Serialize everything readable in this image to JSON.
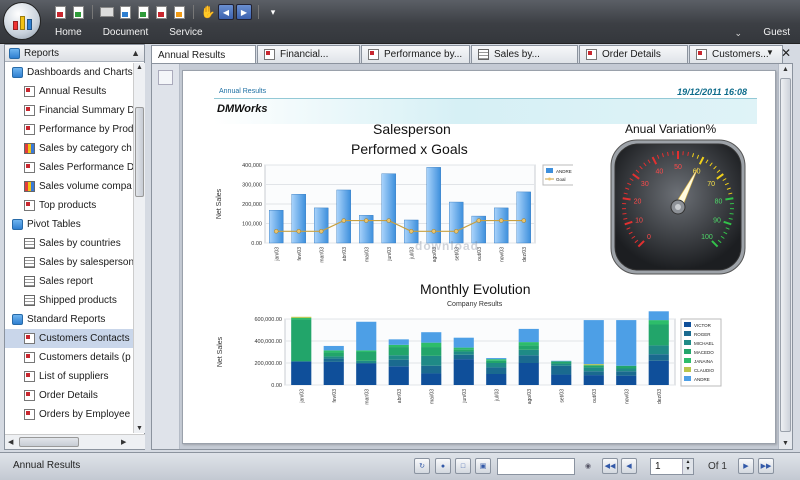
{
  "app": {
    "menu": [
      "Home",
      "Document",
      "Service"
    ],
    "user": "Guest"
  },
  "sidebar": {
    "title": "Reports",
    "groups": [
      {
        "label": "Dashboards and Charts",
        "items": [
          {
            "label": "Annual Results",
            "icon": "report-icon"
          },
          {
            "label": "Financial Summary D",
            "icon": "report-icon"
          },
          {
            "label": "Performance by Prod",
            "icon": "report-icon"
          },
          {
            "label": "Sales by category ch",
            "icon": "chart-icon"
          },
          {
            "label": "Sales Performance D",
            "icon": "report-icon"
          },
          {
            "label": "Sales volume compa",
            "icon": "chart-icon"
          },
          {
            "label": "Top products",
            "icon": "report-icon"
          }
        ]
      },
      {
        "label": "Pivot Tables",
        "items": [
          {
            "label": "Sales by countries",
            "icon": "grid-icon"
          },
          {
            "label": "Sales by salesperson",
            "icon": "grid-icon"
          },
          {
            "label": "Sales report",
            "icon": "grid-icon"
          },
          {
            "label": "Shipped products",
            "icon": "grid-icon"
          }
        ]
      },
      {
        "label": "Standard Reports",
        "items": [
          {
            "label": "Customers Contacts",
            "icon": "report-icon",
            "selected": true
          },
          {
            "label": "Customers details (p",
            "icon": "report-icon"
          },
          {
            "label": "List of suppliers",
            "icon": "report-icon"
          },
          {
            "label": "Order Details",
            "icon": "report-icon"
          },
          {
            "label": "Orders by Employee",
            "icon": "report-icon"
          }
        ]
      }
    ]
  },
  "tabs": [
    {
      "label": "Annual Results",
      "icon": "",
      "active": true
    },
    {
      "label": "Financial...",
      "icon": "report-icon"
    },
    {
      "label": "Performance by...",
      "icon": "report-icon"
    },
    {
      "label": "Sales by...",
      "icon": "grid-icon"
    },
    {
      "label": "Order Details",
      "icon": "report-icon"
    },
    {
      "label": "Customers...",
      "icon": "report-icon"
    }
  ],
  "report": {
    "name": "Annual Results",
    "date": "19/12/2011 16:08",
    "company": "DMWorks",
    "watermark": "download"
  },
  "chart_data": [
    {
      "type": "bar",
      "title": "Salesperson Performed x Goals",
      "title_lines": [
        "Salesperson",
        "Performed x Goals"
      ],
      "ylabel": "Net Sales",
      "ylim": [
        0,
        400000
      ],
      "yticks": [
        "0.00",
        "100,000",
        "200,000",
        "300,000",
        "400,000"
      ],
      "categories": [
        "jan/03",
        "fev/03",
        "mar/03",
        "abr/03",
        "mai/03",
        "jun/03",
        "jul/03",
        "ago/03",
        "set/03",
        "out/03",
        "nov/03",
        "dez/03"
      ],
      "series": [
        {
          "name": "ANDRE",
          "kind": "bar",
          "color": "#3d8fdc",
          "values": [
            168000,
            250000,
            180000,
            272000,
            142000,
            355000,
            118000,
            388000,
            210000,
            138000,
            180000,
            262000
          ]
        },
        {
          "name": "Goal",
          "kind": "line",
          "color": "#c8a040",
          "values": [
            60000,
            60000,
            60000,
            115000,
            115000,
            115000,
            60000,
            60000,
            60000,
            115000,
            115000,
            115000
          ]
        }
      ],
      "legend": "top-right"
    },
    {
      "type": "gauge",
      "title": "Anual Variation%",
      "min": 0,
      "max": 100,
      "ticks": [
        "0",
        "10",
        "20",
        "30",
        "40",
        "50",
        "60",
        "70",
        "80",
        "90",
        "100"
      ],
      "value": 60
    },
    {
      "type": "bar",
      "stacked": true,
      "title": "Monthly Evolution",
      "subtitle": "Company Results",
      "ylabel": "Net Sales",
      "ylim": [
        0,
        600000
      ],
      "yticks": [
        "0.00",
        "200,000.00",
        "400,000.00",
        "600,000.00"
      ],
      "categories": [
        "jan/03",
        "fev/03",
        "mar/03",
        "abr/03",
        "mai/03",
        "jun/03",
        "jul/03",
        "ago/03",
        "set/03",
        "out/03",
        "nov/03",
        "dez/03"
      ],
      "series": [
        {
          "name": "VICTOR",
          "color": "#0f4f9a",
          "values": [
            215000,
            210000,
            195000,
            170000,
            105000,
            235000,
            100000,
            200000,
            95000,
            90000,
            85000,
            220000
          ]
        },
        {
          "name": "ROGER",
          "color": "#1a6a8f",
          "values": [
            0,
            30000,
            5000,
            60000,
            70000,
            40000,
            60000,
            70000,
            80000,
            35000,
            40000,
            60000
          ]
        },
        {
          "name": "MICHAEL",
          "color": "#1f8a86",
          "values": [
            0,
            20000,
            20000,
            40000,
            90000,
            30000,
            40000,
            50000,
            20000,
            35000,
            25000,
            80000
          ]
        },
        {
          "name": "MACEDO",
          "color": "#22a56a",
          "values": [
            380000,
            35000,
            80000,
            75000,
            80000,
            20000,
            20000,
            40000,
            20000,
            20000,
            25000,
            190000
          ]
        },
        {
          "name": "JANAINA",
          "color": "#2dbd6a",
          "values": [
            15000,
            20000,
            15000,
            20000,
            40000,
            15000,
            15000,
            30000,
            0,
            0,
            0,
            40000
          ]
        },
        {
          "name": "CLAUDIO",
          "color": "#b9c64c",
          "values": [
            10000,
            0,
            0,
            0,
            0,
            0,
            0,
            0,
            0,
            10000,
            0,
            0
          ]
        },
        {
          "name": "ANDRE",
          "color": "#4d9fe6",
          "values": [
            0,
            40000,
            260000,
            50000,
            95000,
            90000,
            10000,
            120000,
            5000,
            400000,
            415000,
            80000
          ]
        }
      ],
      "legend": "right"
    }
  ],
  "status": {
    "label": "Annual Results",
    "page": "1",
    "of": "Of 1"
  }
}
